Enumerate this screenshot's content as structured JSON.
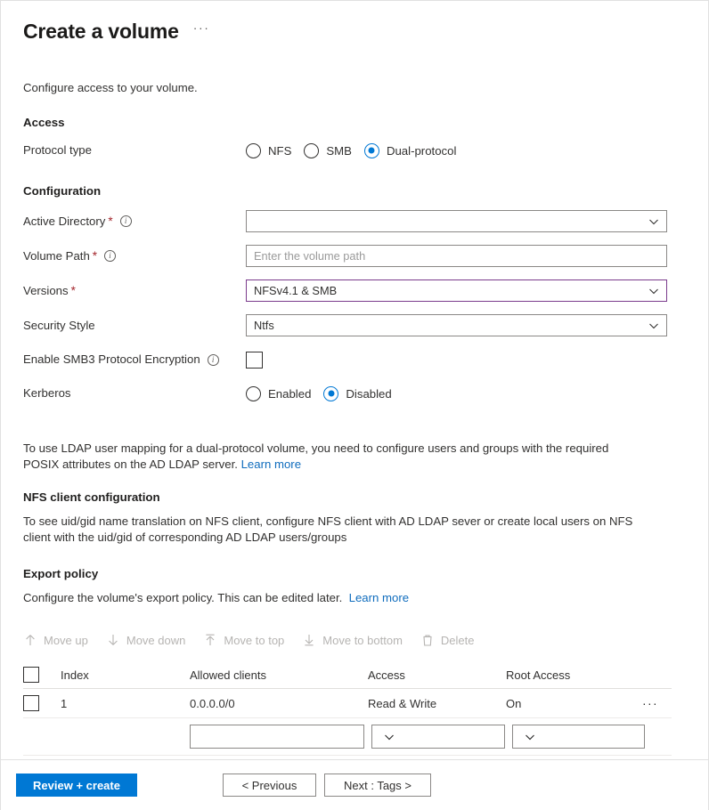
{
  "header": {
    "title": "Create a volume",
    "more_actions": "···"
  },
  "intro": "Configure access to your volume.",
  "access": {
    "heading": "Access",
    "protocol_type_label": "Protocol type",
    "protocol_options": [
      {
        "label": "NFS",
        "checked": false
      },
      {
        "label": "SMB",
        "checked": false
      },
      {
        "label": "Dual-protocol",
        "checked": true
      }
    ]
  },
  "configuration": {
    "heading": "Configuration",
    "active_directory": {
      "label": "Active Directory",
      "required": "*",
      "value": "",
      "placeholder": ""
    },
    "volume_path": {
      "label": "Volume Path",
      "required": "*",
      "value": "",
      "placeholder": "Enter the volume path"
    },
    "versions": {
      "label": "Versions",
      "required": "*",
      "value": "NFSv4.1 & SMB",
      "accent_color": "#7a3b8c"
    },
    "security_style": {
      "label": "Security Style",
      "value": "Ntfs"
    },
    "smb3_encryption": {
      "label": "Enable SMB3 Protocol Encryption",
      "checked": false
    },
    "kerberos": {
      "label": "Kerberos",
      "options": [
        {
          "label": "Enabled",
          "checked": false
        },
        {
          "label": "Disabled",
          "checked": true
        }
      ]
    }
  },
  "notes": {
    "ldap_text": "To use LDAP user mapping for a dual-protocol volume, you need to configure users and groups with the required POSIX attributes on the AD LDAP server.",
    "ldap_link": "Learn more",
    "nfs_client_heading": "NFS client configuration",
    "nfs_client_text": "To see uid/gid name translation on NFS client, configure NFS client with AD LDAP sever or create local users on NFS client with the uid/gid of corresponding AD LDAP users/groups"
  },
  "export_policy": {
    "heading": "Export policy",
    "description": "Configure the volume's export policy. This can be edited later.",
    "link": "Learn more",
    "toolbar": [
      {
        "label": "Move up",
        "icon": "arrow-up-icon",
        "disabled": true
      },
      {
        "label": "Move down",
        "icon": "arrow-down-icon",
        "disabled": true
      },
      {
        "label": "Move to top",
        "icon": "arrow-to-top-icon",
        "disabled": true
      },
      {
        "label": "Move to bottom",
        "icon": "arrow-to-bottom-icon",
        "disabled": true
      },
      {
        "label": "Delete",
        "icon": "trash-icon",
        "disabled": true
      }
    ],
    "columns": [
      "Index",
      "Allowed clients",
      "Access",
      "Root Access"
    ],
    "rows": [
      {
        "index": "1",
        "allowed_clients": "0.0.0.0/0",
        "access": "Read & Write",
        "root_access": "On",
        "menu": "···"
      }
    ],
    "editor_row": {
      "allowed_clients_value": "",
      "access_value": "",
      "root_access_value": ""
    }
  },
  "footer": {
    "review_create": "Review + create",
    "previous": "< Previous",
    "next": "Next : Tags >",
    "primary_color": "#0078d4"
  }
}
